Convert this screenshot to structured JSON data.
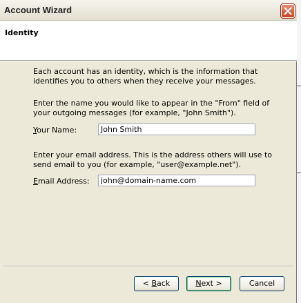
{
  "window": {
    "title": "Account Wizard",
    "close_icon": "close-icon"
  },
  "page": {
    "heading": "Identity"
  },
  "intro": {
    "text": "Each account has an identity, which is the information that identifies you to others when they receive your messages."
  },
  "name_section": {
    "instructions": "Enter the name you would like to appear in the \"From\" field of your outgoing messages (for example, \"John Smith\").",
    "label_mnemonic": "Y",
    "label_rest": "our Name:",
    "value": "John Smith"
  },
  "email_section": {
    "instructions": "Enter your email address. This is the address others will use to send email to you (for example, \"user@example.net\").",
    "label_mnemonic": "E",
    "label_rest": "mail Address:",
    "value": "john@domain-name.com"
  },
  "buttons": {
    "back_prefix": "< ",
    "back_mnemonic": "B",
    "back_rest": "ack",
    "next_mnemonic": "N",
    "next_rest": "ext >",
    "cancel": "Cancel"
  },
  "colors": {
    "dialog_bg": "#ece9d8",
    "header_bg": "#ffffff",
    "close_button": "#c8431f",
    "default_button_glow": "#6aca6a"
  }
}
